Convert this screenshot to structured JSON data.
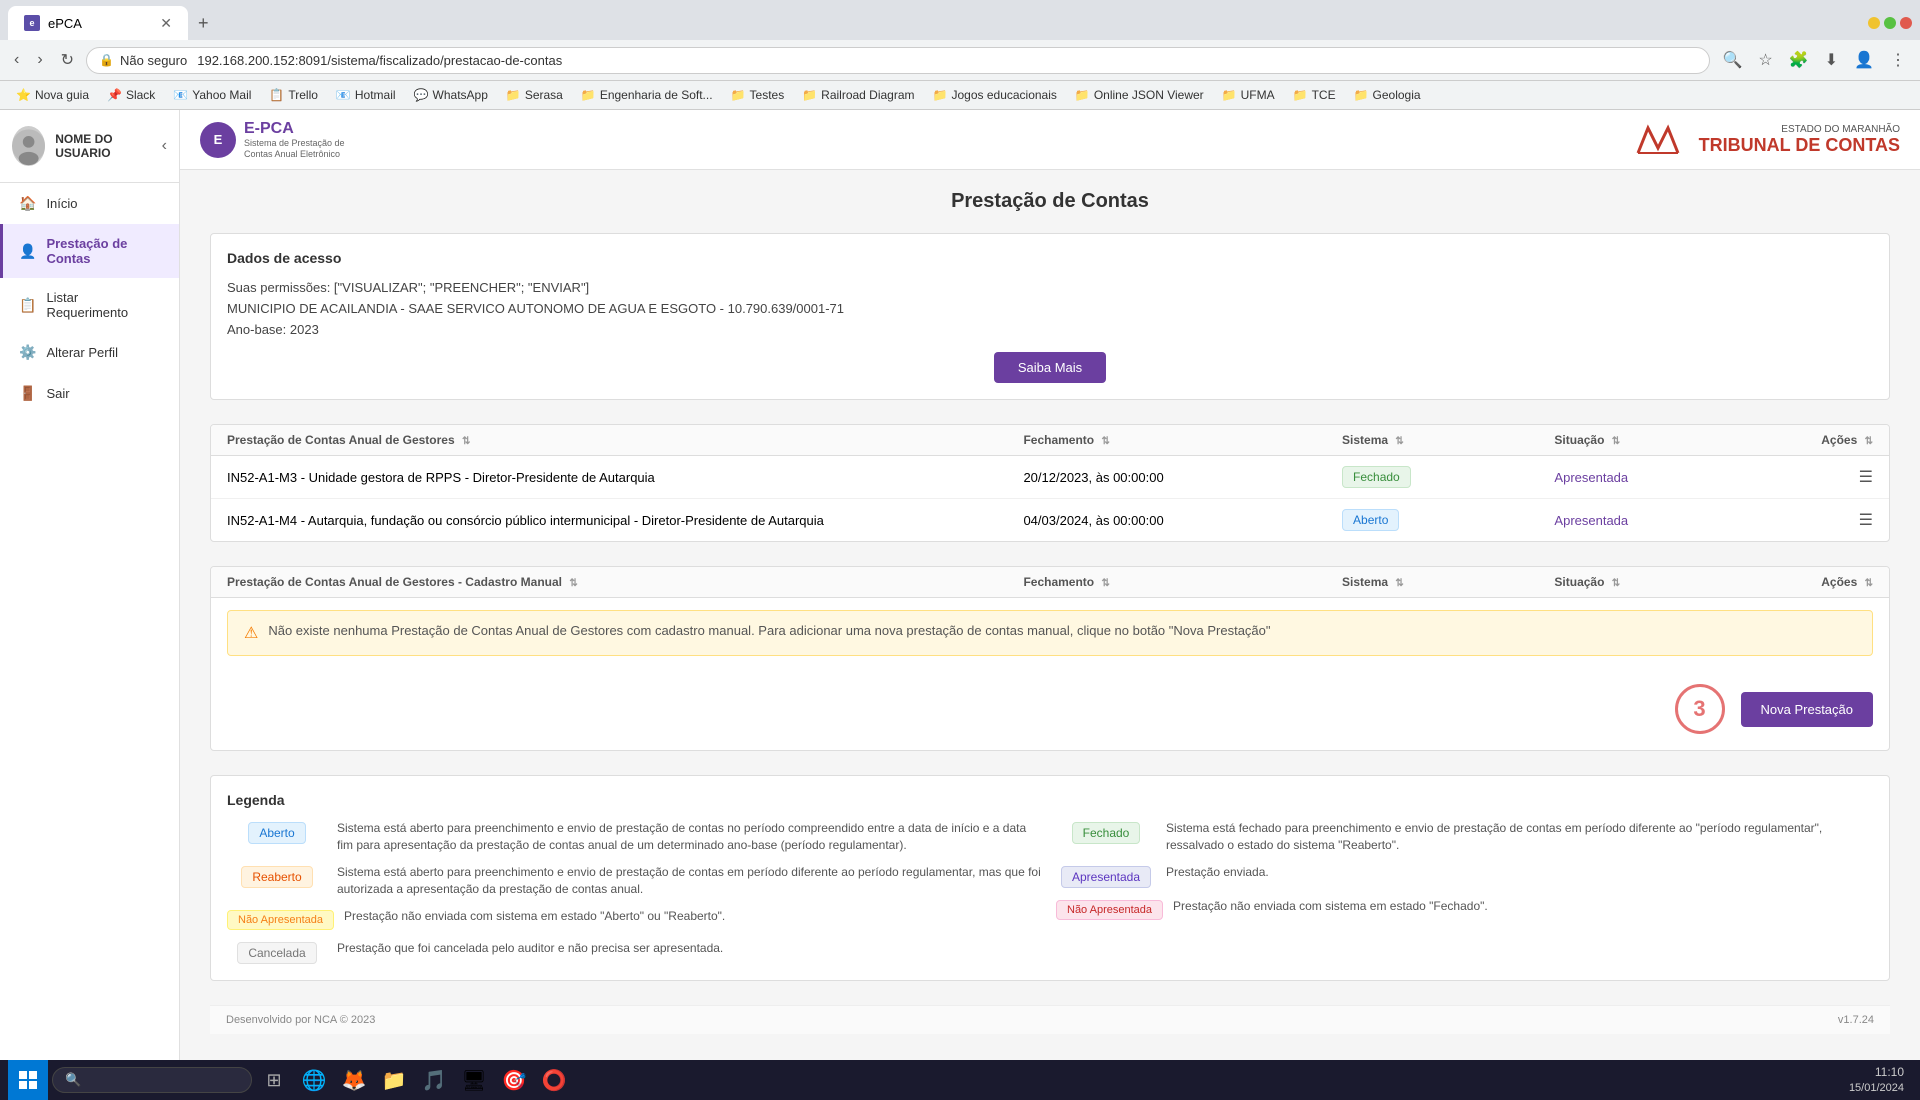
{
  "browser": {
    "tab_label": "ePCA",
    "url": "192.168.200.152:8091/sistema/fiscalizado/prestacao-de-contas",
    "url_protocol": "Não seguro",
    "tab_new_label": "+",
    "bookmarks": [
      {
        "label": "Nova guia",
        "icon": "🔖"
      },
      {
        "label": "Slack",
        "icon": "📌"
      },
      {
        "label": "Yahoo Mail",
        "icon": "📧"
      },
      {
        "label": "Trello",
        "icon": "📋"
      },
      {
        "label": "Hotmail",
        "icon": "📧"
      },
      {
        "label": "WhatsApp",
        "icon": "💬"
      },
      {
        "label": "Serasa",
        "icon": "📁"
      },
      {
        "label": "Engenharia de Soft...",
        "icon": "📁"
      },
      {
        "label": "Testes",
        "icon": "📁"
      },
      {
        "label": "Railroad Diagram",
        "icon": "📁"
      },
      {
        "label": "Jogos educacionais",
        "icon": "📁"
      },
      {
        "label": "Online JSON Viewer",
        "icon": "📁"
      },
      {
        "label": "UFMA",
        "icon": "📁"
      },
      {
        "label": "TCE",
        "icon": "📁"
      },
      {
        "label": "Geologia",
        "icon": "📁"
      }
    ]
  },
  "sidebar": {
    "username": "NOME DO USUARIO",
    "items": [
      {
        "id": "inicio",
        "label": "Início",
        "icon": "🏠",
        "active": false
      },
      {
        "id": "prestacao",
        "label": "Prestação de Contas",
        "icon": "👤",
        "active": true
      },
      {
        "id": "listar",
        "label": "Listar Requerimento",
        "icon": "📋",
        "active": false
      },
      {
        "id": "alterar",
        "label": "Alterar Perfil",
        "icon": "⚙️",
        "active": false
      },
      {
        "id": "sair",
        "label": "Sair",
        "icon": "🚪",
        "active": false
      }
    ]
  },
  "header": {
    "logo_text": "E-PCA",
    "logo_subtitle": "Sistema de Prestação de Contas Anual Eletrônico",
    "tribunal_estado": "ESTADO DO MARANHÃO",
    "tribunal_name": "TRIBUNAL DE CONTAS"
  },
  "main": {
    "page_title": "Prestação de Contas",
    "dados_acesso": {
      "title": "Dados de acesso",
      "permissoes_label": "Suas permissões: [\"VISUALIZAR\"; \"PREENCHER\"; \"ENVIAR\"]",
      "municipio": "MUNICIPIO DE ACAILANDIA - SAAE SERVICO AUTONOMO DE AGUA E ESGOTO - 10.790.639/0001-71",
      "ano_base": "Ano-base: 2023",
      "btn_saiba_mais": "Saiba Mais"
    },
    "table1": {
      "title": "Prestação de Contas Anual de Gestores",
      "columns": [
        "Prestação de Contas Anual de Gestores",
        "Fechamento",
        "Sistema",
        "Situação",
        "Ações"
      ],
      "rows": [
        {
          "descricao": "IN52-A1-M3 - Unidade gestora de RPPS - Diretor-Presidente de Autarquia",
          "fechamento": "20/12/2023, às 00:00:00",
          "sistema": "Fechado",
          "sistema_type": "fechado",
          "situacao": "Apresentada",
          "situacao_type": "apresentada"
        },
        {
          "descricao": "IN52-A1-M4 - Autarquia, fundação ou consórcio público intermunicipal - Diretor-Presidente de Autarquia",
          "fechamento": "04/03/2024, às 00:00:00",
          "sistema": "Aberto",
          "sistema_type": "aberto",
          "situacao": "Apresentada",
          "situacao_type": "apresentada"
        }
      ]
    },
    "table2": {
      "title": "Prestação de Contas Anual de Gestores - Cadastro Manual",
      "columns": [
        "Prestação de Contas Anual de Gestores - Cadastro Manual",
        "Fechamento",
        "Sistema",
        "Situação",
        "Ações"
      ],
      "warning": "Não existe nenhuma Prestação de Contas Anual de Gestores com cadastro manual. Para adicionar uma nova prestação de contas manual, clique no botão \"Nova Prestação\"",
      "badge_number": "3",
      "btn_nova_prestacao": "Nova Prestação"
    },
    "legenda": {
      "title": "Legenda",
      "items_left": [
        {
          "badge": "Aberto",
          "badge_type": "aberto",
          "desc": "Sistema está aberto para preenchimento e envio de prestação de contas no período compreendido entre a data de início e a data fim para apresentação da prestação de contas anual de um determinado ano-base (período regulamentar)."
        },
        {
          "badge": "Reaberto",
          "badge_type": "reaberto",
          "desc": "Sistema está aberto para preenchimento e envio de prestação de contas em período diferente ao período regulamentar, mas que foi autorizada a apresentação da prestação de contas anual."
        },
        {
          "badge": "Não Apresentada",
          "badge_type": "nao-apresentada-yellow",
          "desc": "Prestação não enviada com sistema em estado \"Aberto\" ou \"Reaberto\"."
        },
        {
          "badge": "Cancelada",
          "badge_type": "cancelada",
          "desc": "Prestação que foi cancelada pelo auditor e não precisa ser apresentada."
        }
      ],
      "items_right": [
        {
          "badge": "Fechado",
          "badge_type": "fechado",
          "desc": "Sistema está fechado para preenchimento e envio de prestação de contas em período diferente ao \"período regulamentar\", ressalvado o estado do sistema \"Reaberto\"."
        },
        {
          "badge": "Apresentada",
          "badge_type": "apresentada",
          "desc": "Prestação enviada."
        },
        {
          "badge": "Não Apresentada",
          "badge_type": "nao-apresentada-red",
          "desc": "Prestação não enviada com sistema em estado \"Fechado\"."
        }
      ]
    }
  },
  "footer": {
    "desenvolvido": "Desenvolvido por NCA © 2023",
    "version": "v1.7.24"
  },
  "taskbar": {
    "time": "11:10",
    "date": "15/01/2024",
    "apps": [
      "🗂",
      "🔍",
      "🗂",
      "🌐",
      "🦊",
      "📁",
      "🎵",
      "🖥",
      "🎯"
    ]
  }
}
